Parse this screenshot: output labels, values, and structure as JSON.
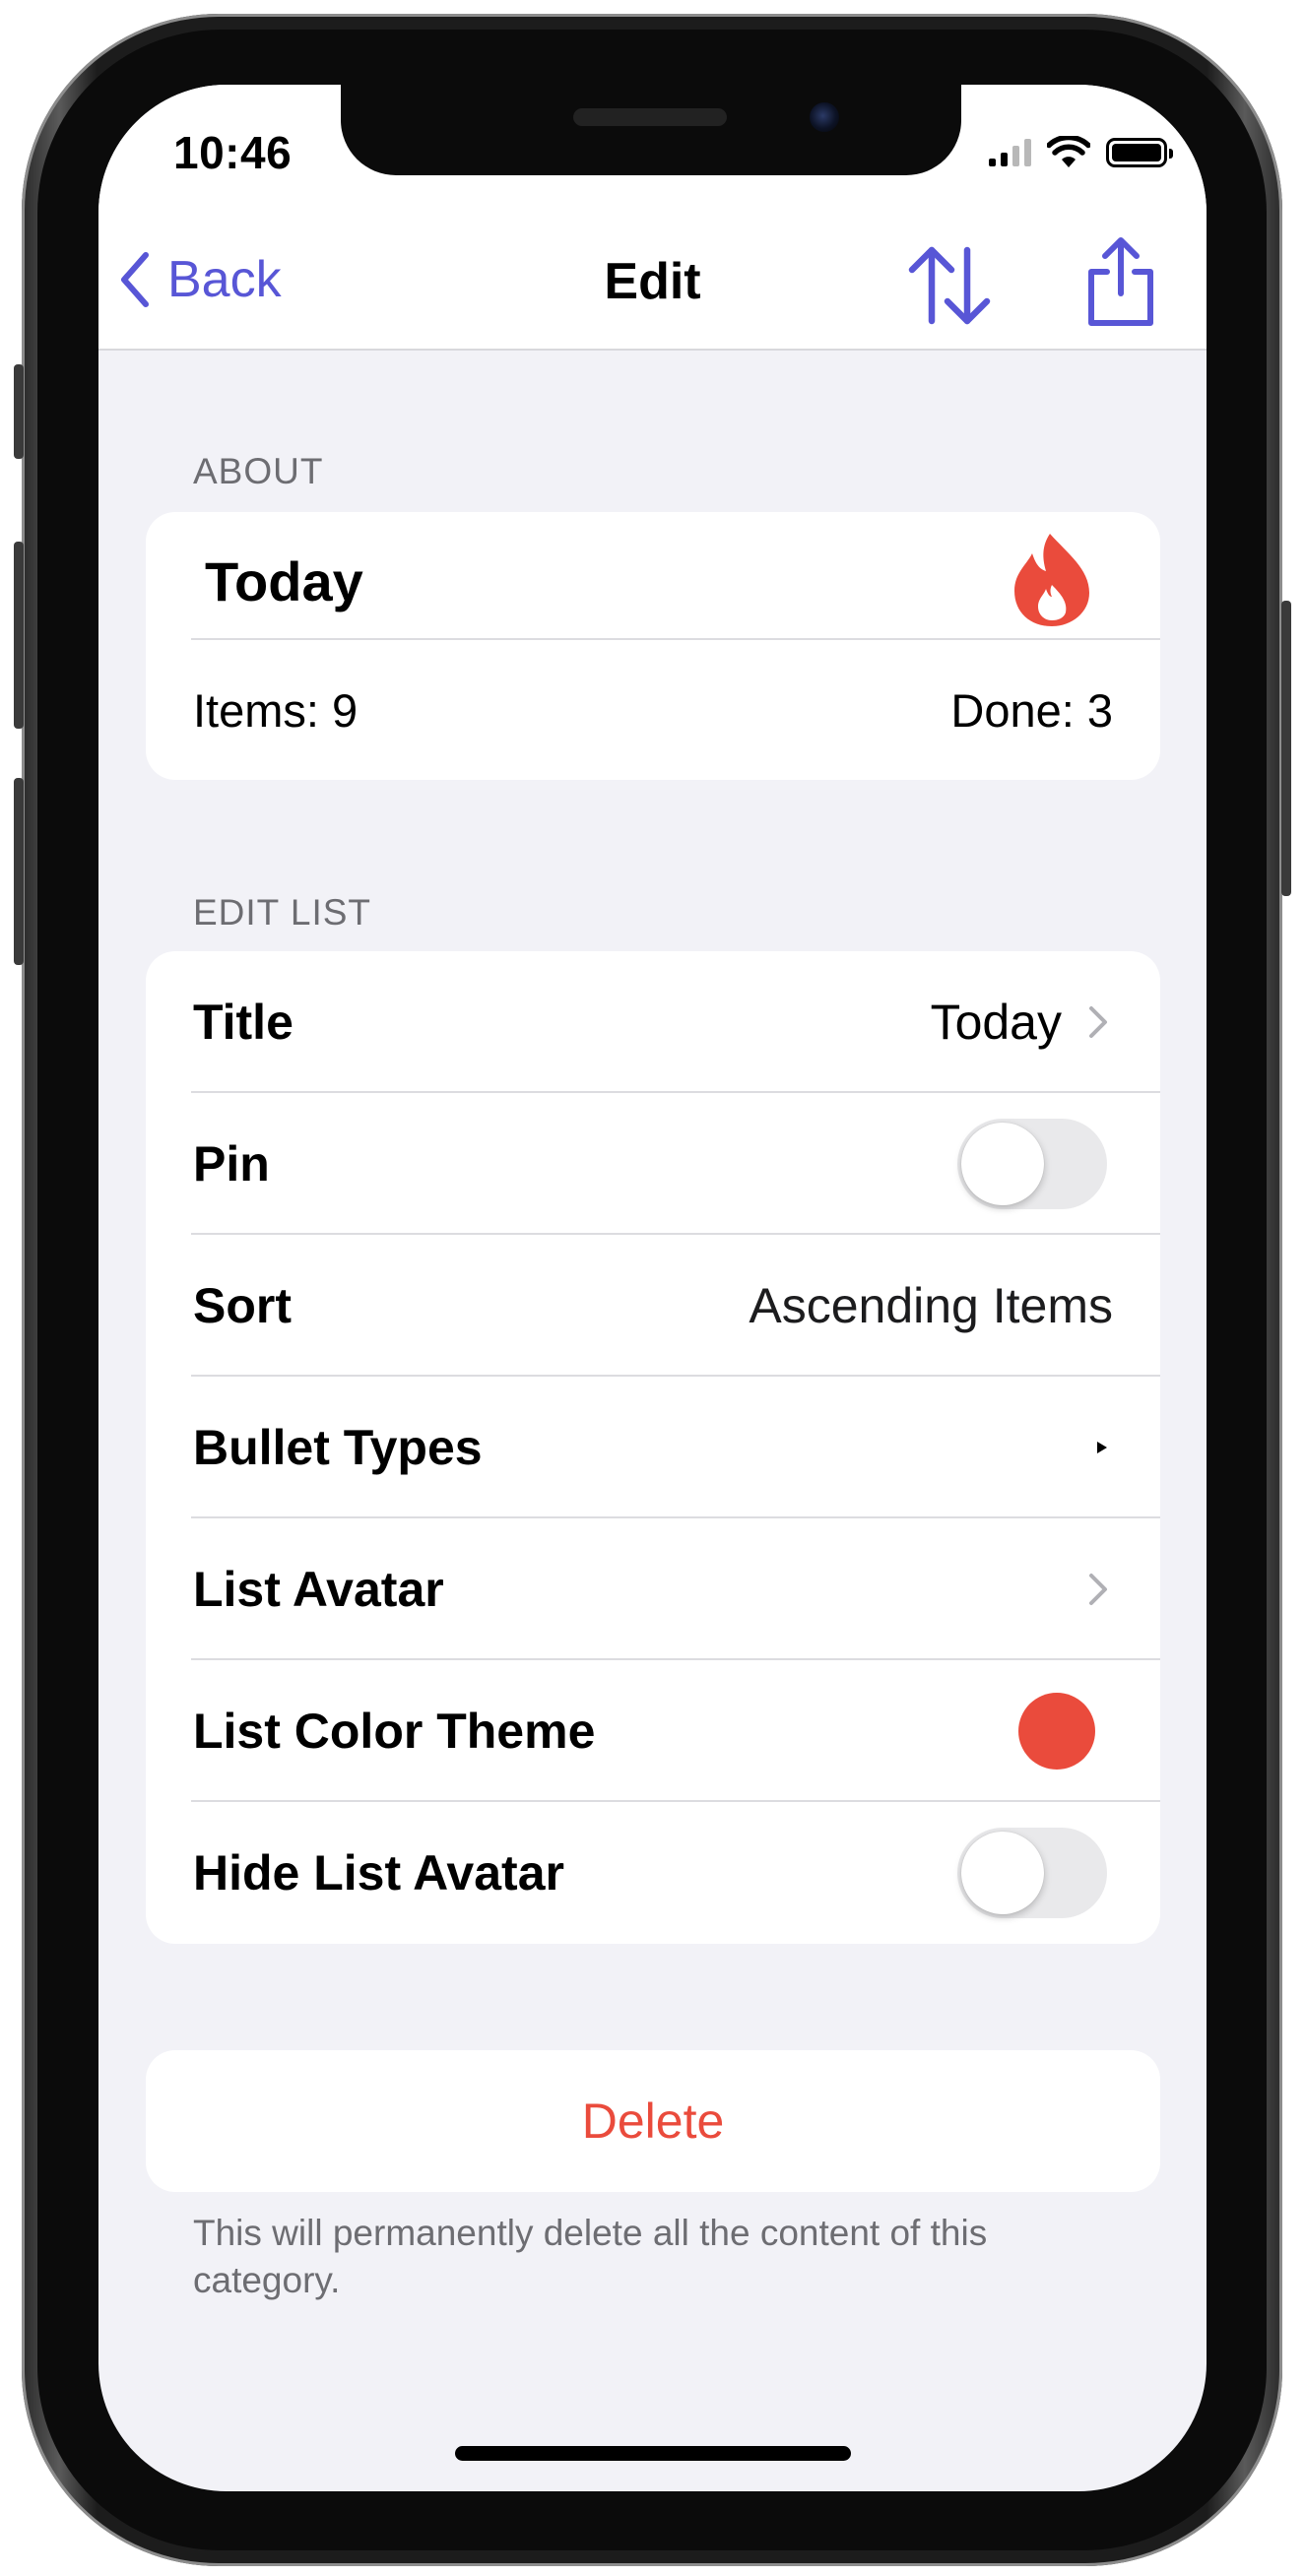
{
  "status_bar": {
    "time": "10:46"
  },
  "nav": {
    "back_label": "Back",
    "title": "Edit",
    "accent_color": "#5856d6"
  },
  "about": {
    "header": "ABOUT",
    "list_name": "Today",
    "avatar_icon": "flame-icon",
    "items_label": "Items: 9",
    "done_label": "Done: 3"
  },
  "edit_list": {
    "header": "EDIT LIST",
    "title_label": "Title",
    "title_value": "Today",
    "pin_label": "Pin",
    "pin_on": false,
    "sort_label": "Sort",
    "sort_value": "Ascending Items",
    "bullet_types_label": "Bullet Types",
    "list_avatar_label": "List Avatar",
    "color_theme_label": "List Color Theme",
    "color_theme_value": "#ea4b3c",
    "hide_avatar_label": "Hide List Avatar",
    "hide_avatar_on": false
  },
  "delete": {
    "label": "Delete",
    "color": "#ea4b3c",
    "footer": "This will permanently delete all the content of this category."
  }
}
